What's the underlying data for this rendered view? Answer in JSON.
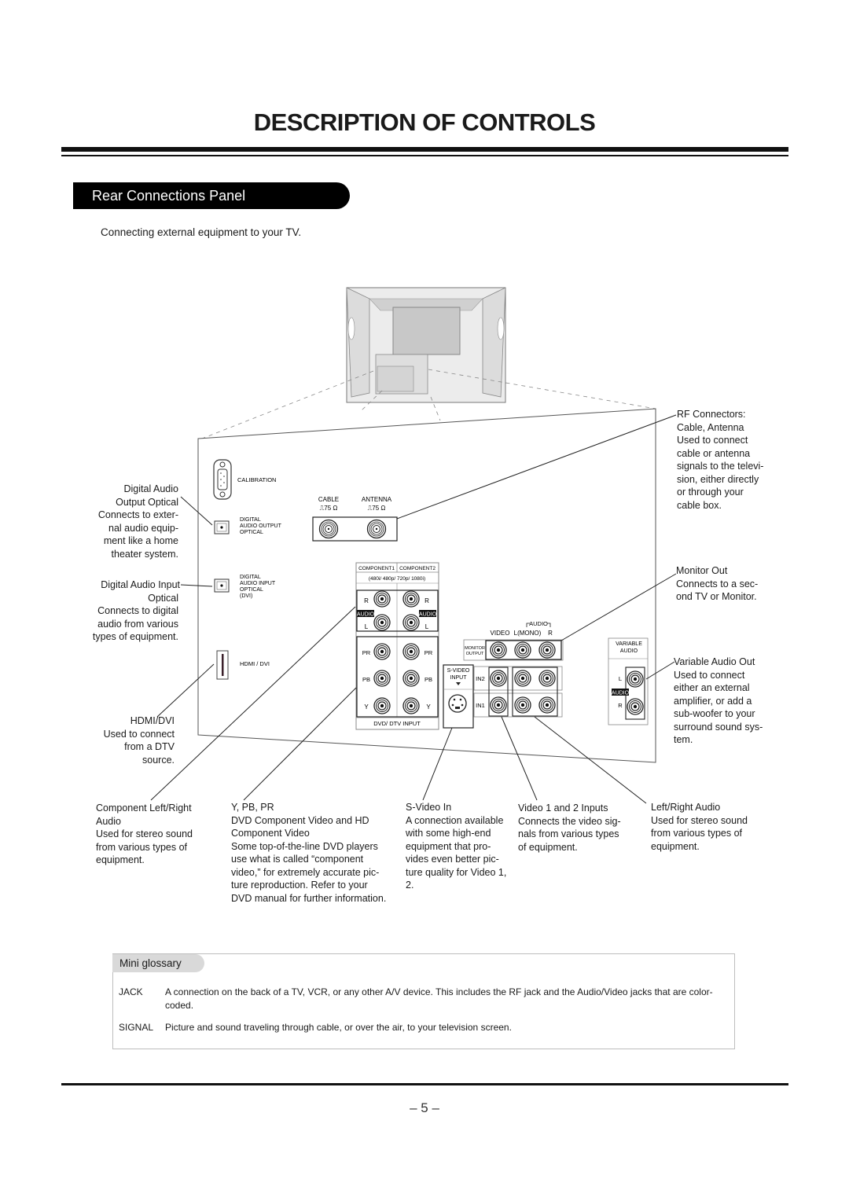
{
  "page": {
    "title": "DESCRIPTION OF CONTROLS",
    "section_title": "Rear Connections Panel",
    "intro": "Connecting external equipment to your TV.",
    "page_number": "– 5 –"
  },
  "panel_labels": {
    "calibration": "CALIBRATION",
    "digital_audio_output": [
      "DIGITAL",
      "AUDIO OUTPUT",
      "OPTICAL"
    ],
    "digital_audio_input": [
      "DIGITAL",
      "AUDIO INPUT",
      "OPTICAL",
      "(DVI)"
    ],
    "hdmi_dvi": "HDMI / DVI",
    "cable": "CABLE",
    "antenna": "ANTENNA",
    "impedance": "⎍75 Ω",
    "component1": "COMPONENT1",
    "component2": "COMPONENT2",
    "component_formats": "(480i/ 480p/ 720p/ 1080i)",
    "audio": "AUDIO",
    "r": "R",
    "l": "L",
    "pr": "PR",
    "pb": "PB",
    "y": "Y",
    "dvd_dtv_input": "DVD/ DTV INPUT",
    "s_video_input": [
      "S-VIDEO",
      "INPUT"
    ],
    "in2": "IN2",
    "in1": "IN1",
    "monitor_output": [
      "MONITOR",
      "OUTPUT"
    ],
    "video": "VIDEO",
    "l_mono": "L(MONO)",
    "audio_bracket": "AUDIO",
    "variable_audio": [
      "VARIABLE",
      "AUDIO"
    ]
  },
  "callouts": {
    "digital_audio_output": [
      "Digital Audio",
      "Output Optical",
      "Connects to exter-",
      "nal audio equip-",
      "ment like a home",
      "theater system."
    ],
    "digital_audio_input": [
      "Digital Audio Input",
      "Optical",
      "Connects to digital",
      "audio from various",
      "types of equipment."
    ],
    "hdmi_dvi": [
      "HDMI/DVI",
      "Used to connect",
      "from a DTV",
      "source."
    ],
    "rf_connectors": [
      "RF Connectors:",
      "Cable, Antenna",
      "Used to connect",
      "cable or antenna",
      "signals to the televi-",
      "sion, either directly",
      "or through your",
      "cable box."
    ],
    "monitor_out": [
      "Monitor Out",
      "Connects to a sec-",
      "ond TV or Monitor."
    ],
    "variable_audio_out": [
      "Variable Audio Out",
      "Used to connect",
      "either an external",
      "amplifier, or add a",
      "sub-woofer to your",
      "surround sound sys-",
      "tem."
    ],
    "component_audio": [
      "Component Left/Right",
      "Audio",
      "Used for stereo sound",
      "from various types of",
      "equipment."
    ],
    "component_video": [
      "Y, PB, PR",
      "DVD Component Video and HD",
      "Component Video",
      "Some top-of-the-line DVD players",
      "use what is called “component",
      "video,” for extremely accurate pic-",
      "ture reproduction. Refer to your",
      "DVD manual for further information."
    ],
    "s_video_in": [
      "S-Video In",
      "A connection available",
      "with some high-end",
      "equipment that pro-",
      "vides even better pic-",
      "ture quality for Video 1,",
      "2."
    ],
    "video_inputs": [
      "Video 1 and 2 Inputs",
      "Connects the video sig-",
      "nals from various types",
      "of equipment."
    ],
    "left_right_audio": [
      "Left/Right Audio",
      "Used for stereo sound",
      "from various types of",
      "equipment."
    ]
  },
  "glossary": {
    "title": "Mini glossary",
    "entries": [
      {
        "term": "JACK",
        "definition": "A connection on the back of a TV, VCR, or any other A/V device. This includes the RF jack and the Audio/Video jacks that are color-coded."
      },
      {
        "term": "SIGNAL",
        "definition": "Picture and sound traveling through cable, or over the air, to your television screen."
      }
    ]
  }
}
